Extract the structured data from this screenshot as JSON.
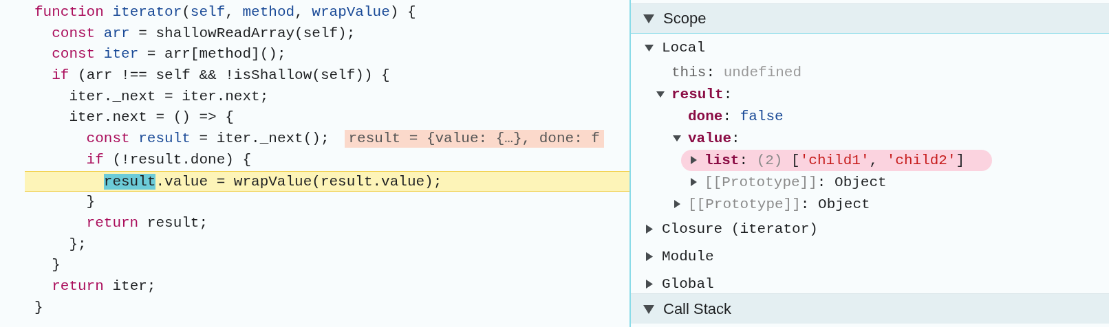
{
  "code": {
    "lines": [
      {
        "current": false,
        "tokens": [
          {
            "text": "function ",
            "kind": "keyword"
          },
          {
            "text": "iterator",
            "kind": "identifier"
          },
          {
            "text": "(",
            "kind": "plain"
          },
          {
            "text": "self",
            "kind": "identifier"
          },
          {
            "text": ", ",
            "kind": "plain"
          },
          {
            "text": "method",
            "kind": "identifier"
          },
          {
            "text": ", ",
            "kind": "plain"
          },
          {
            "text": "wrapValue",
            "kind": "identifier"
          },
          {
            "text": ") {",
            "kind": "plain"
          }
        ]
      },
      {
        "current": false,
        "tokens": [
          {
            "text": "  const ",
            "kind": "keyword"
          },
          {
            "text": "arr",
            "kind": "identifier"
          },
          {
            "text": " = shallowReadArray(self);",
            "kind": "plain"
          }
        ]
      },
      {
        "current": false,
        "tokens": [
          {
            "text": "  const ",
            "kind": "keyword"
          },
          {
            "text": "iter",
            "kind": "identifier"
          },
          {
            "text": " = arr[method]();",
            "kind": "plain"
          }
        ]
      },
      {
        "current": false,
        "tokens": [
          {
            "text": "  if",
            "kind": "keyword"
          },
          {
            "text": " (arr !== self && !isShallow(self)) {",
            "kind": "plain"
          }
        ]
      },
      {
        "current": false,
        "tokens": [
          {
            "text": "    iter._next = iter.next;",
            "kind": "plain"
          }
        ]
      },
      {
        "current": false,
        "tokens": [
          {
            "text": "    iter.next = () => {",
            "kind": "plain"
          }
        ]
      },
      {
        "current": false,
        "tokens": [
          {
            "text": "      const ",
            "kind": "keyword"
          },
          {
            "text": "result",
            "kind": "identifier"
          },
          {
            "text": " = iter._next();",
            "kind": "plain"
          }
        ],
        "inline_value": "result = {value: {…}, done: f"
      },
      {
        "current": false,
        "tokens": [
          {
            "text": "      if",
            "kind": "keyword"
          },
          {
            "text": " (!result.done) {",
            "kind": "plain"
          }
        ]
      },
      {
        "current": true,
        "tokens": [
          {
            "text": "        result",
            "kind": "match"
          },
          {
            "text": ".value = wrapValue(result.value);",
            "kind": "plain"
          }
        ]
      },
      {
        "current": false,
        "tokens": [
          {
            "text": "      }",
            "kind": "plain"
          }
        ]
      },
      {
        "current": false,
        "tokens": [
          {
            "text": "      return",
            "kind": "keyword"
          },
          {
            "text": " result;",
            "kind": "plain"
          }
        ]
      },
      {
        "current": false,
        "tokens": [
          {
            "text": "    };",
            "kind": "plain"
          }
        ]
      },
      {
        "current": false,
        "tokens": [
          {
            "text": "  }",
            "kind": "plain"
          }
        ]
      },
      {
        "current": false,
        "tokens": [
          {
            "text": "  return",
            "kind": "keyword"
          },
          {
            "text": " iter;",
            "kind": "plain"
          }
        ]
      },
      {
        "current": false,
        "tokens": [
          {
            "text": "}",
            "kind": "plain"
          }
        ]
      }
    ]
  },
  "scope": {
    "title": "Scope",
    "expanded": true,
    "sections": [
      {
        "name": "Local",
        "expanded": true,
        "properties": [
          {
            "marked": false,
            "parts": [
              {
                "text": "this",
                "kind": "receiver"
              },
              {
                "text": ": ",
                "kind": "plain"
              },
              {
                "text": "undefined",
                "kind": "undefined"
              }
            ]
          },
          {
            "marked": false,
            "expanded": true,
            "parts": [
              {
                "text": "result",
                "kind": "key"
              },
              {
                "text": ":",
                "kind": "plain"
              }
            ],
            "children": [
              {
                "marked": false,
                "parts": [
                  {
                    "text": "done",
                    "kind": "key"
                  },
                  {
                    "text": ": ",
                    "kind": "plain"
                  },
                  {
                    "text": "false",
                    "kind": "literal"
                  }
                ]
              },
              {
                "marked": false,
                "expanded": true,
                "parts": [
                  {
                    "text": "value",
                    "kind": "key"
                  },
                  {
                    "text": ":",
                    "kind": "plain"
                  }
                ],
                "children": [
                  {
                    "marked": true,
                    "expanded": false,
                    "parts": [
                      {
                        "text": "list",
                        "kind": "key"
                      },
                      {
                        "text": ": ",
                        "kind": "plain"
                      },
                      {
                        "text": "(2)",
                        "kind": "count"
                      },
                      {
                        "text": " [",
                        "kind": "plain"
                      },
                      {
                        "text": "'child1'",
                        "kind": "string"
                      },
                      {
                        "text": ", ",
                        "kind": "plain"
                      },
                      {
                        "text": "'child2'",
                        "kind": "string"
                      },
                      {
                        "text": "]",
                        "kind": "plain"
                      }
                    ]
                  },
                  {
                    "marked": false,
                    "expanded": false,
                    "parts": [
                      {
                        "text": "[[Prototype]]",
                        "kind": "internal"
                      },
                      {
                        "text": ": Object",
                        "kind": "plain"
                      }
                    ]
                  }
                ]
              },
              {
                "marked": false,
                "expanded": false,
                "parts": [
                  {
                    "text": "[[Prototype]]",
                    "kind": "internal"
                  },
                  {
                    "text": ": Object",
                    "kind": "plain"
                  }
                ]
              }
            ]
          }
        ]
      },
      {
        "name": "Closure (iterator)",
        "expanded": false
      },
      {
        "name": "Module",
        "expanded": false
      },
      {
        "name": "Global",
        "expanded": false
      }
    ]
  },
  "call_stack": {
    "title": "Call Stack",
    "expanded": true
  }
}
